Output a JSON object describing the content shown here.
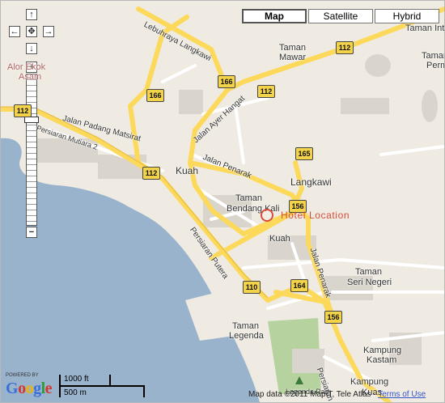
{
  "map_type_buttons": [
    {
      "label": "Map",
      "selected": true
    },
    {
      "label": "Satellite",
      "selected": false
    },
    {
      "label": "Hybrid",
      "selected": false
    }
  ],
  "nav": {
    "up": "↑",
    "left": "←",
    "center": "✥",
    "right": "→",
    "down": "↓",
    "zoom_in": "+",
    "zoom_out": "−"
  },
  "places": {
    "alor_ekok": "Alor Ekok",
    "asam": "Asam",
    "taman_mawar_1": "Taman",
    "taman_mawar_2": "Mawar",
    "taman_int": "Taman Int",
    "taman_right": "Taman",
    "perm": "Perm",
    "kuah_1": "Kuah",
    "langkawi": "Langkawi",
    "taman_bendang_1": "Taman",
    "taman_bendang_2": "Bendang Kali",
    "kuah_2": "Kuah",
    "taman_seri_1": "Taman",
    "taman_seri_2": "Seri Negeri",
    "taman_legenda_1": "Taman",
    "taman_legenda_2": "Legenda",
    "kampung_kastam_1": "Kampung",
    "kampung_kastam_2": "Kastam",
    "kampung_kuas_1": "Kampung",
    "kampung_kuas_2": "Kuas",
    "legenda_park": "Legenda Park"
  },
  "roads": {
    "lebuhraya": "Lebuhraya Langkawi",
    "padang_matsirat": "Jalan Padang Matsirat",
    "mutiara": "Persiaran Mutiara 2",
    "ayer_hangat": "Jalan Ayer Hangat",
    "penarak_1": "Jalan Penarak",
    "penarak_2": "Jalan Penarak",
    "putera_1": "Persiaran Putera",
    "putera_2": "Persiaran"
  },
  "shields": [
    "112",
    "166",
    "112",
    "112",
    "166",
    "112",
    "165",
    "156",
    "110",
    "164",
    "156"
  ],
  "hotel": {
    "label": "Hotel Location",
    "color": "#d94b3a"
  },
  "scale": {
    "imperial": "1000 ft",
    "metric": "500 m"
  },
  "branding": {
    "powered_by": "POWERED BY",
    "logo": "Google"
  },
  "copyright": {
    "text": "Map data ©2011 MapIT, Tele Atlas - ",
    "terms": "Terms of Use"
  },
  "colors": {
    "land": "#efebe2",
    "water": "#99b3cc",
    "park": "#b5d29f",
    "major_road": "#fcd95a",
    "minor_road": "#ffffff"
  }
}
